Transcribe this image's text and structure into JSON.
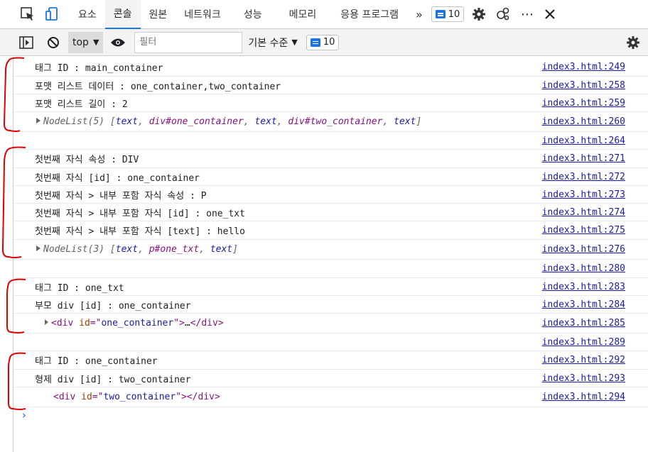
{
  "tabs": {
    "items": [
      "요소",
      "콘솔",
      "원본",
      "네트워크",
      "성능",
      "메모리",
      "응용 프로그램"
    ],
    "active_index": 1,
    "more_label": "»",
    "issues_count": "10"
  },
  "toolbar": {
    "context": "top",
    "filter_placeholder": "필터",
    "level_label": "기본 수준",
    "issues_count": "10"
  },
  "console": {
    "rows": [
      {
        "text": "태그 ID : main_container",
        "source": "index3.html:249"
      },
      {
        "text": "포맷 리스트 데이터 : one_container,two_container",
        "source": "index3.html:258"
      },
      {
        "text": "포맷 리스트 길이 : 2",
        "source": "index3.html:259"
      },
      {
        "nodelist_prefix": "NodeList(5) [",
        "items": [
          "text",
          "div#one_container",
          "text",
          "div#two_container",
          "text"
        ],
        "suffix": "]",
        "source": "index3.html:260"
      },
      {
        "text": "",
        "source": "index3.html:264"
      },
      {
        "text": "첫번째 자식 속성 : DIV",
        "source": "index3.html:271"
      },
      {
        "text": "첫번째 자식 [id] : one_container",
        "source": "index3.html:272"
      },
      {
        "text": "첫번째 자식 > 내부 포함 자식 속성 : P",
        "source": "index3.html:273"
      },
      {
        "text": "첫번째 자식 > 내부 포함 자식 [id] : one_txt",
        "source": "index3.html:274"
      },
      {
        "text": "첫번째 자식 > 내부 포함 자식 [text] : hello",
        "source": "index3.html:275"
      },
      {
        "nodelist_prefix": "NodeList(3) [",
        "items": [
          "text",
          "p#one_txt",
          "text"
        ],
        "suffix": "]",
        "source": "index3.html:276"
      },
      {
        "text": "",
        "source": "index3.html:280"
      },
      {
        "text": "태그 ID : one_txt",
        "source": "index3.html:283"
      },
      {
        "text": "부모 div [id] : one_container",
        "source": "index3.html:284"
      },
      {
        "element": {
          "tag": "div",
          "attr": "id",
          "value": "one_container",
          "collapsed": "…"
        },
        "source": "index3.html:285"
      },
      {
        "text": "",
        "source": "index3.html:289"
      },
      {
        "text": "태그 ID : one_container",
        "source": "index3.html:292"
      },
      {
        "text": "형제 div [id] : two_container",
        "source": "index3.html:293"
      },
      {
        "element": {
          "tag": "div",
          "attr": "id",
          "value": "two_container",
          "collapsed": ""
        },
        "source": "index3.html:294"
      }
    ],
    "prompt_symbol": "›"
  },
  "colors": {
    "accent": "#1a73e8",
    "link": "#1a1aa6",
    "annotation": "#e00000"
  }
}
